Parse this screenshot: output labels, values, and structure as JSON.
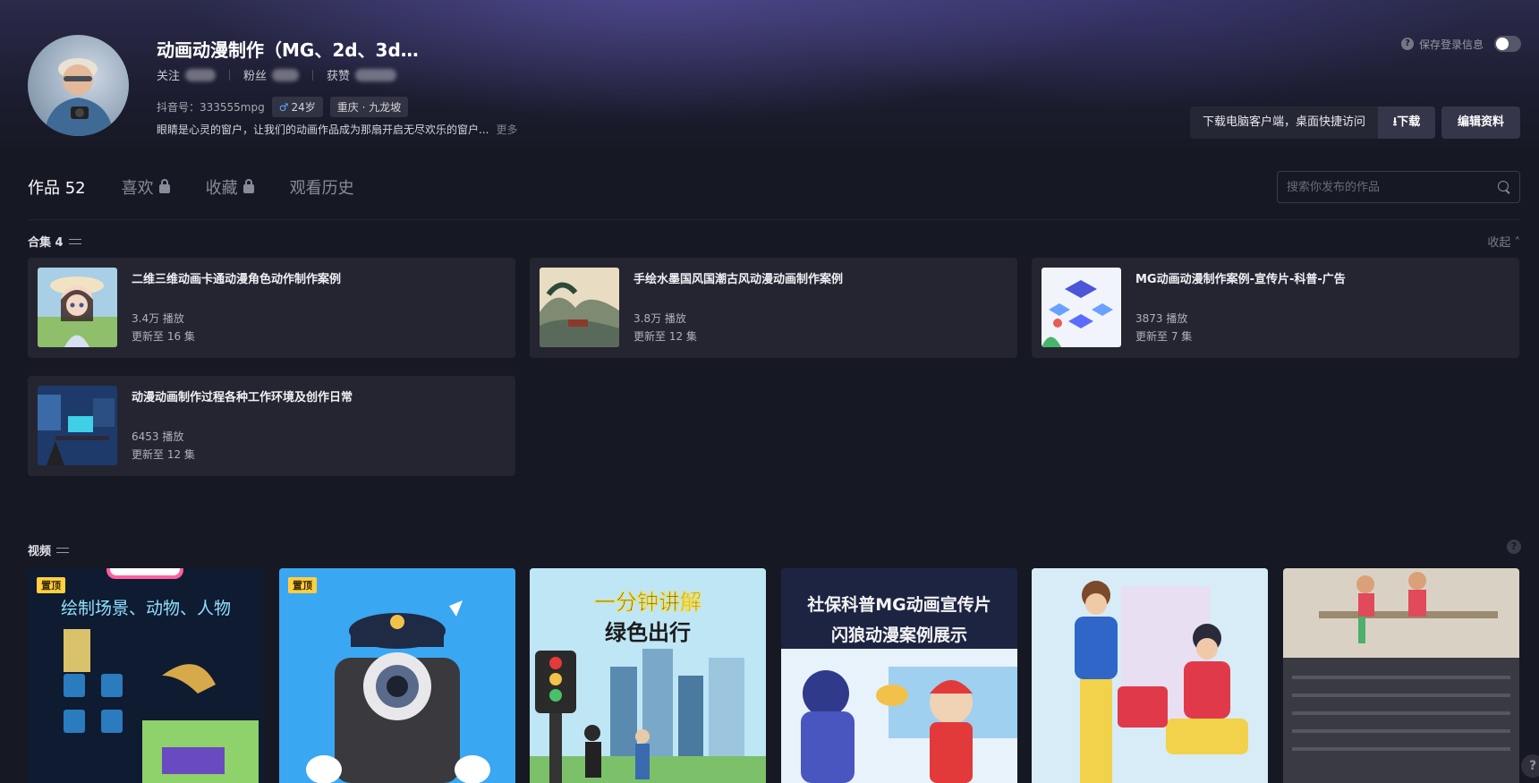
{
  "profile": {
    "name": "动画动漫制作（MG、2d、3d…",
    "follow_label": "关注",
    "fans_label": "粉丝",
    "likes_label": "获赞",
    "douyin_id": "抖音号：333555mpg",
    "gender_age": "24岁",
    "location": "重庆 · 九龙坡",
    "bio": "眼睛是心灵的窗户，让我们的动画作品成为那扇开启无尽欢乐的窗户...",
    "bio_more": "更多"
  },
  "top_right": {
    "save_login_label": "保存登录信息",
    "help_glyph": "?",
    "download_text": "下载电脑客户端，桌面快捷访问",
    "download_button": "⭳下载",
    "edit_button": "编辑资料"
  },
  "tabs": [
    {
      "label": "作品 52"
    },
    {
      "label": "喜欢"
    },
    {
      "label": "收藏"
    },
    {
      "label": "观看历史"
    }
  ],
  "search": {
    "placeholder": "搜索你发布的作品"
  },
  "collections_section": {
    "title": "合集 4",
    "collapse_label": "收起 ˄",
    "items": [
      {
        "title": "二维三维动画卡通动漫角色动作制作案例",
        "plays": "3.4万 播放",
        "update": "更新至 16 集"
      },
      {
        "title": "手绘水墨国风国潮古风动漫动画制作案例",
        "plays": "3.8万 播放",
        "update": "更新至 12 集"
      },
      {
        "title": "MG动画动漫制作案例-宣传片-科普-广告",
        "plays": "3873 播放",
        "update": "更新至 7 集"
      },
      {
        "title": "动漫动画制作过程各种工作环境及创作日常",
        "plays": "6453 播放",
        "update": "更新至 12 集"
      }
    ]
  },
  "videos_section": {
    "title": "视频",
    "help_glyph": "?",
    "items": [
      {
        "pinned_label": "置顶",
        "caption": "绘制场景、动物、人物"
      },
      {
        "pinned_label": "置顶",
        "caption": ""
      },
      {
        "pinned_label": "",
        "caption_line1": "一分钟讲解",
        "caption_line2": "绿色出行"
      },
      {
        "pinned_label": "",
        "caption_line1": "社保科普MG动画宣传片",
        "caption_line2": "闪狼动漫案例展示"
      },
      {
        "pinned_label": "",
        "caption": ""
      },
      {
        "pinned_label": "",
        "caption": ""
      }
    ]
  },
  "corner_glyph": "?"
}
